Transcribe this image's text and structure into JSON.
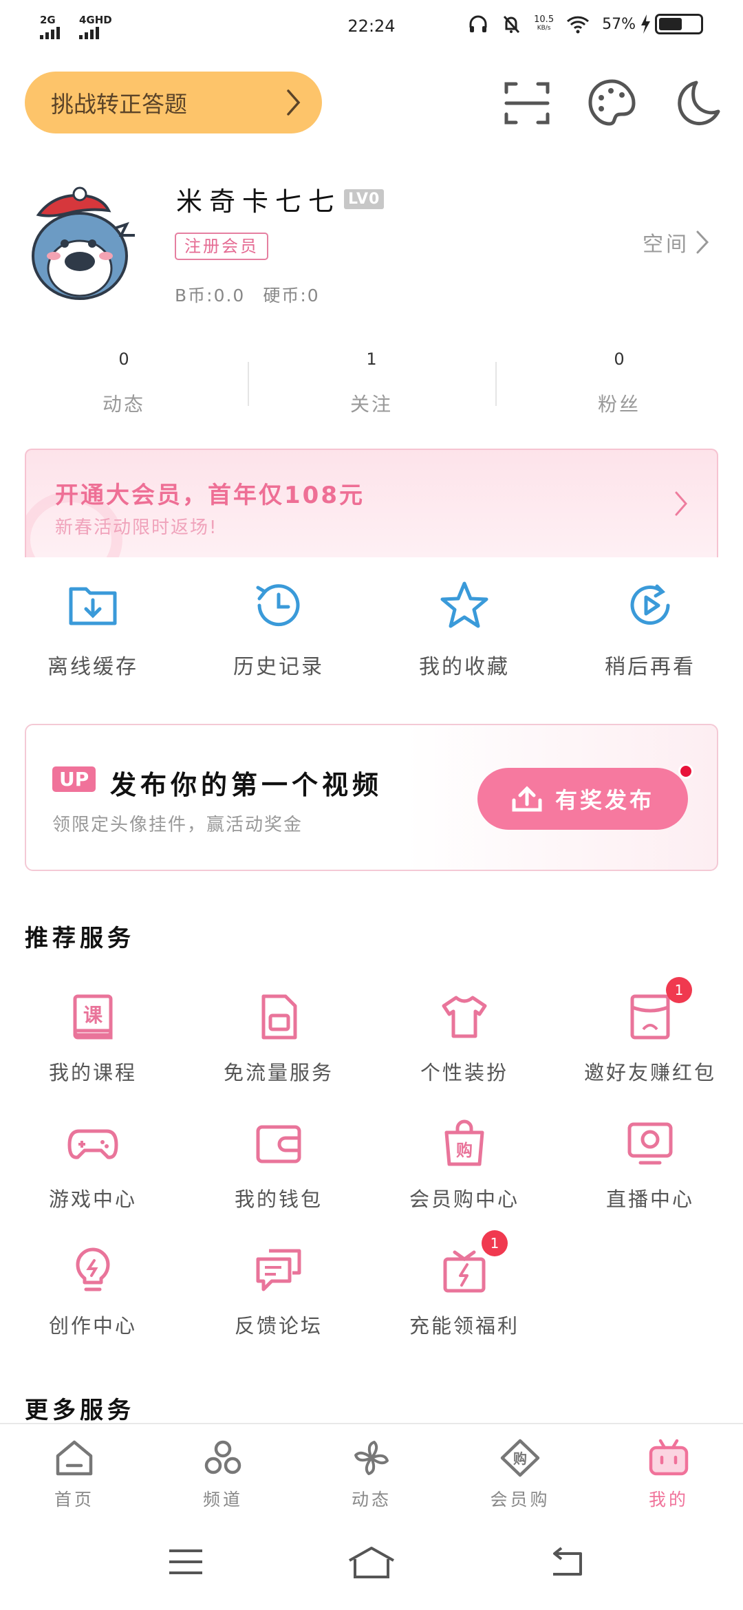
{
  "status_bar": {
    "signal_1": "2G",
    "signal_2": "4GHD",
    "time": "22:24",
    "net_speed_value": "10.5",
    "net_speed_unit": "KB/s",
    "battery": "57%",
    "battery_level": 0.57
  },
  "top_bar": {
    "challenge_label": "挑战转正答题",
    "icons": [
      "scan-icon",
      "palette-icon",
      "moon-icon"
    ]
  },
  "profile": {
    "username": "米奇卡七七",
    "level": "LV0",
    "member_tag": "注册会员",
    "b_coins": "B币:0.0",
    "coins": "硬币:0",
    "space_label": "空间"
  },
  "stats": [
    {
      "value": "0",
      "label": "动态"
    },
    {
      "value": "1",
      "label": "关注"
    },
    {
      "value": "0",
      "label": "粉丝"
    }
  ],
  "vip_banner": {
    "title": "开通大会员，首年仅108元",
    "subtitle": "新春活动限时返场!"
  },
  "quick_actions": [
    {
      "label": "离线缓存",
      "icon": "download-folder-icon"
    },
    {
      "label": "历史记录",
      "icon": "history-clock-icon"
    },
    {
      "label": "我的收藏",
      "icon": "star-icon"
    },
    {
      "label": "稍后再看",
      "icon": "watch-later-icon"
    }
  ],
  "up_card": {
    "badge": "UP",
    "title": "发布你的第一个视频",
    "subtitle": "领限定头像挂件，赢活动奖金",
    "button_label": "有奖发布"
  },
  "recommended": {
    "title": "推荐服务",
    "items": [
      {
        "label": "我的课程",
        "icon": "course-book-icon",
        "badge": "",
        "icon_text": "课"
      },
      {
        "label": "免流量服务",
        "icon": "sim-card-icon",
        "badge": ""
      },
      {
        "label": "个性装扮",
        "icon": "tshirt-icon",
        "badge": ""
      },
      {
        "label": "邀好友赚红包",
        "icon": "red-envelope-icon",
        "badge": "1"
      },
      {
        "label": "游戏中心",
        "icon": "gamepad-icon",
        "badge": ""
      },
      {
        "label": "我的钱包",
        "icon": "wallet-icon",
        "badge": ""
      },
      {
        "label": "会员购中心",
        "icon": "shopping-bag-icon",
        "badge": "",
        "icon_text": "购"
      },
      {
        "label": "直播中心",
        "icon": "live-tv-icon",
        "badge": ""
      },
      {
        "label": "创作中心",
        "icon": "lightbulb-icon",
        "badge": ""
      },
      {
        "label": "反馈论坛",
        "icon": "chat-bubbles-icon",
        "badge": ""
      },
      {
        "label": "充能领福利",
        "icon": "gift-box-icon",
        "badge": "1"
      }
    ]
  },
  "more_services": {
    "title": "更多服务"
  },
  "bottom_nav": [
    {
      "label": "首页",
      "icon": "home-icon",
      "active": false
    },
    {
      "label": "频道",
      "icon": "channel-icon",
      "active": false
    },
    {
      "label": "动态",
      "icon": "pinwheel-icon",
      "active": false
    },
    {
      "label": "会员购",
      "icon": "vip-shop-icon",
      "active": false,
      "icon_text": "购"
    },
    {
      "label": "我的",
      "icon": "bilibili-tv-icon",
      "active": true
    }
  ],
  "colors": {
    "accent_pink": "#f0729a",
    "quick_blue": "#3a9ad9",
    "challenge_yellow": "#fdc46a",
    "badge_red": "#f0394f"
  }
}
